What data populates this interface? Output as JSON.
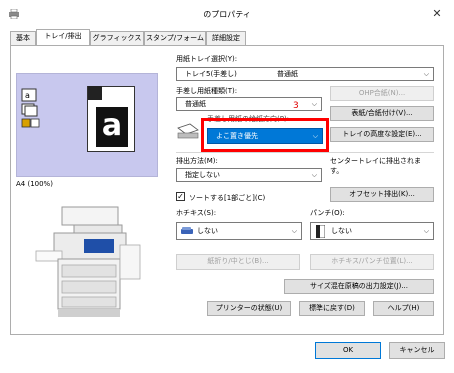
{
  "window": {
    "title": "のプロパティ"
  },
  "tabs": [
    "基本",
    "トレイ/排出",
    "グラフィックス",
    "スタンプ/フォーム",
    "詳細設定"
  ],
  "preview": {
    "caption": "A4 (100%)",
    "letter": "a"
  },
  "tray": {
    "label": "用紙トレイ選択(Y):",
    "value": "トレイ5(手差し)",
    "value2": "普通紙"
  },
  "manual_paper": {
    "label": "手差し用紙種類(T):",
    "value": "普通紙",
    "ohp_button": "OHP合紙(N)...",
    "cover_button": "表紙/合紙付け(V)...",
    "orient_label": "手差し用紙の給紙方向(P):",
    "orient_value": "よこ置き優先",
    "advanced_button": "トレイの高度な設定(E)...",
    "annotation_number": "3"
  },
  "output": {
    "label": "排出方法(M):",
    "value": "指定しない",
    "note": "センタートレイに排出されます。",
    "offset_button": "オフセット排出(K)...",
    "sort_checkbox": "ソートする[1部ごと](C)",
    "sort_checked": true
  },
  "stapler": {
    "label": "ホチキス(S):",
    "value": "しない"
  },
  "punch": {
    "label": "パンチ(O):",
    "value": "しない"
  },
  "buttons": {
    "fold": "紙折り/中とじ(B)...",
    "staple_pos": "ホチキス/パンチ位置(L)...",
    "mixed_size": "サイズ混在原稿の出力設定(J)...",
    "printer_status": "プリンターの状態(U)",
    "restore": "標準に戻す(D)",
    "help": "ヘルプ(H)",
    "ok": "OK",
    "cancel": "キャンセル"
  },
  "colors": {
    "highlight": "#0078d7",
    "annotation": "#ff0000",
    "preview_bg": "#c8c8ee"
  }
}
